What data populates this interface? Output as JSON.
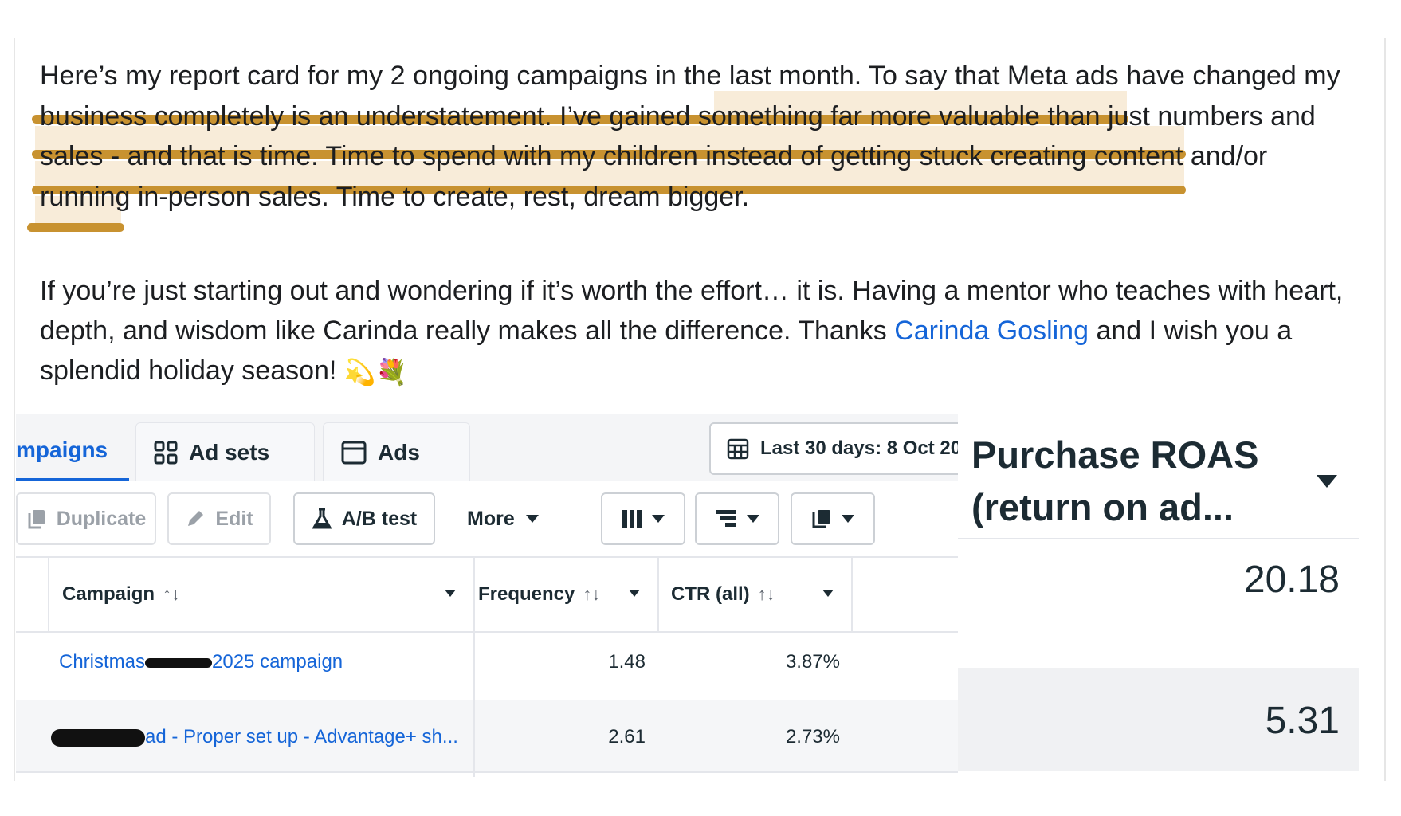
{
  "post": {
    "para1_plain": "Here’s my report card for my 2 ongoing campaigns in the last month. To say that Meta ads have changed my business completely is an understatement. ",
    "para1_highlight": "I’ve gained something far more valuable than just numbers and sales - and that is time. Time to spend with my children instead of getting stuck creating content and/or running in-person sales. Time to create, rest, dream bigger.",
    "para2_text": "If you’re just starting out and wondering if it’s worth the effort… it is. Having a mentor who teaches with heart, depth, and wisdom like Carinda really makes all the difference. Thanks ",
    "mention": "Carinda Gosling",
    "para2_end": " and I wish you a splendid holiday season! ",
    "emoji_1": "💫",
    "emoji_2": "💐"
  },
  "colors": {
    "highlight": "#f8ecd9",
    "underline": "#c89230",
    "link": "#1565d8"
  },
  "ads_manager": {
    "tabs": [
      {
        "label": "mpaigns",
        "icon": "campaigns-tab"
      },
      {
        "label": "Ad sets",
        "icon": "grid-icon"
      },
      {
        "label": "Ads",
        "icon": "window-icon"
      }
    ],
    "date_range": "Last 30 days: 8 Oct 20",
    "toolbar": {
      "duplicate": "Duplicate",
      "edit": "Edit",
      "ab_test": "A/B test",
      "more": "More"
    },
    "columns": {
      "campaign": "Campaign",
      "frequency": "Frequency",
      "ctr": "CTR (all)",
      "sort_glyph": "↑↓"
    },
    "rows": [
      {
        "campaign_prefix": "Christmas",
        "campaign_suffix": "2025 campaign",
        "frequency": "1.48",
        "ctr": "3.87%"
      },
      {
        "campaign_prefix": "",
        "campaign_suffix": "ad - Proper set up - Advantage+ sh...",
        "frequency": "2.61",
        "ctr": "2.73%"
      }
    ]
  },
  "roas": {
    "title": "Purchase ROAS (return on ad...",
    "values": [
      "20.18",
      "5.31"
    ]
  }
}
